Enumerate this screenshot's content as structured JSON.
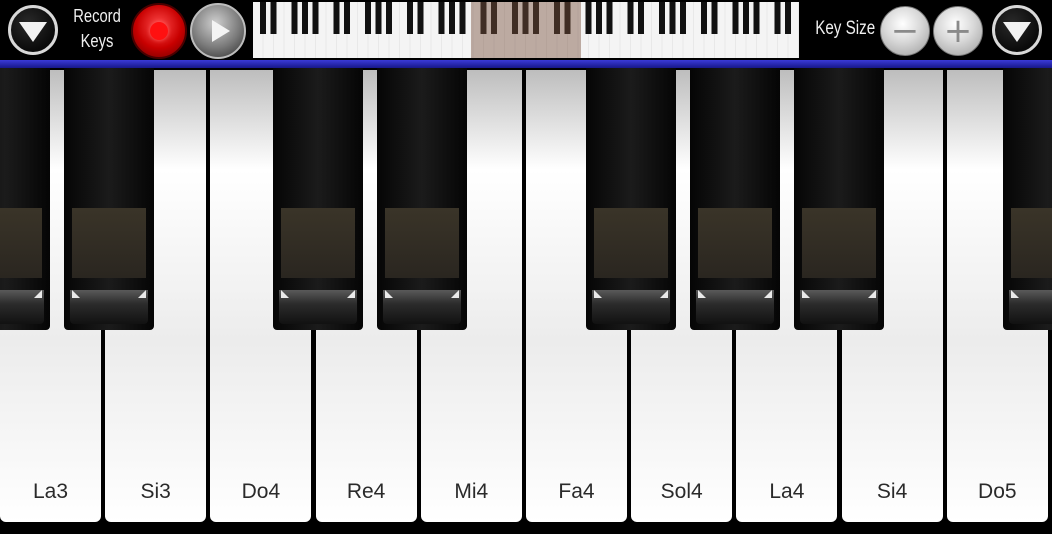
{
  "toolbar": {
    "record_label_line1": "Record",
    "record_label_line2": "Keys",
    "key_size_label": "Key Size",
    "minus_symbol": "−",
    "plus_symbol": "+"
  },
  "keyboard": {
    "white_keys": [
      "La3",
      "Si3",
      "Do4",
      "Re4",
      "Mi4",
      "Fa4",
      "Sol4",
      "La4",
      "Si4",
      "Do5"
    ]
  },
  "colors": {
    "record": "#d00000",
    "accent_bar": "#2a2ab8"
  },
  "icons": [
    "chevron-down-icon",
    "record-icon",
    "play-icon",
    "minus-icon",
    "plus-icon"
  ]
}
